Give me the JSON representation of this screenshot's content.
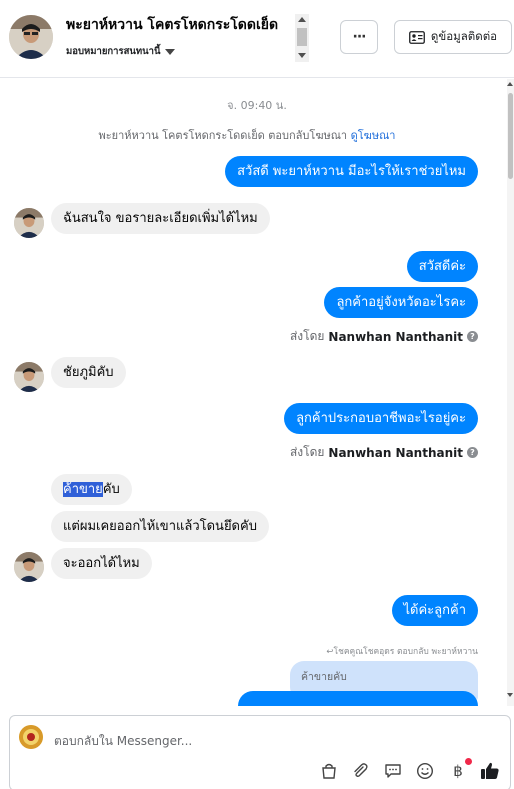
{
  "header": {
    "name": "พะยาห์หวาน โคตรโหดกระโดดเย็ด",
    "assign_label": "มอบหมายการสนทนานี้",
    "more_label": "···",
    "contact_label": "ดูข้อมูลติดต่อ"
  },
  "thread": {
    "timestamp": "จ. 09:40 น.",
    "system_line": "พะยาห์หวาน โคตรโหดกระโดดเย็ด ตอบกลับโฆษณา",
    "system_link": "ดูโฆษณา",
    "msg1": "สวัสดี พะยาห์หวาน มีอะไรให้เราช่วยไหม",
    "msg2": "ฉันสนใจ ขอรายละเอียดเพิ่มได้ไหม",
    "msg3": "สวัสดีค่ะ",
    "msg4": "ลูกค้าอยู่จังหวัดอะไรคะ",
    "sent_by_prefix": "ส่งโดย",
    "sender": "Nanwhan Nanthanit",
    "msg5": "ชัยภูมิคับ",
    "msg6": "ลูกค้าประกอบอาชีพอะไรอยู่คะ",
    "msg7_highlight": "ค้าขาย",
    "msg7_rest": "คับ",
    "msg8": "แต่ผมเคยออกไห้เขาแล้วโดนยึดคับ",
    "msg9": "จะออกได้ไหม",
    "msg10": "ได้ค่ะลูกค้า",
    "reply_note": "โชคคูณโชคอุดร ตอบกลับ พะยาห์หวาน",
    "quoted": "ค้าขายคับ"
  },
  "composer": {
    "placeholder": "ตอบกลับใน Messenger..."
  },
  "colors": {
    "outgoing": "#0084ff",
    "incoming": "#f0f0f0",
    "link": "#216fdb",
    "like": "#1c1e21"
  }
}
